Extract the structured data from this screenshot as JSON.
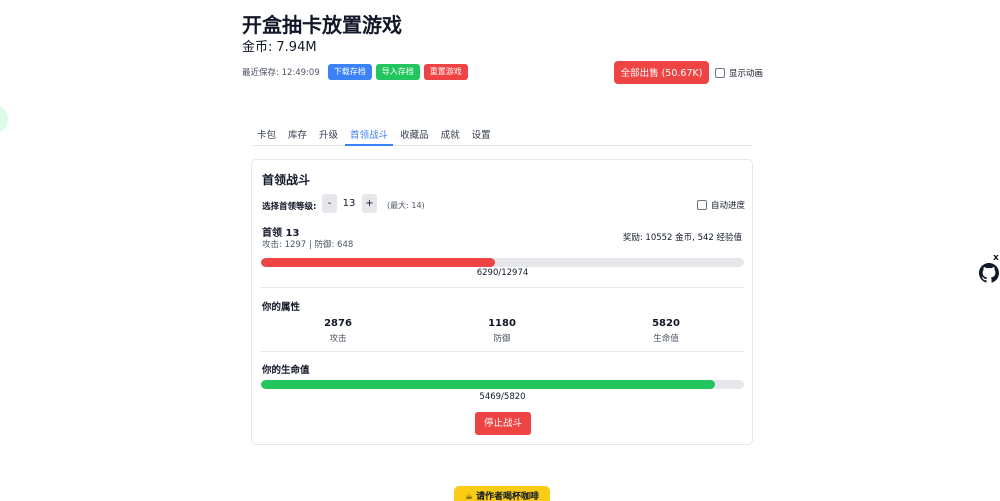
{
  "header": {
    "title": "开盒抽卡放置游戏",
    "gold_label": "金币:",
    "gold_value": "7.94M"
  },
  "save_bar": {
    "last_saved": "最近保存: 12:49:09",
    "download_label": "下载存档",
    "import_label": "导入存档",
    "reset_label": "重置游戏"
  },
  "actions": {
    "sell_all_label": "全部出售 (50.67K)",
    "show_animation_label": "显示动画",
    "show_animation_checked": false
  },
  "tabs": [
    {
      "label": "卡包",
      "active": false
    },
    {
      "label": "库存",
      "active": false
    },
    {
      "label": "升级",
      "active": false
    },
    {
      "label": "首领战斗",
      "active": true
    },
    {
      "label": "收藏品",
      "active": false
    },
    {
      "label": "成就",
      "active": false
    },
    {
      "label": "设置",
      "active": false
    }
  ],
  "boss_battle": {
    "title": "首领战斗",
    "select_level_label": "选择首领等级:",
    "minus_label": "-",
    "plus_label": "+",
    "level": "13",
    "max_label": "(最大: 14)",
    "auto_progress_label": "自动进度",
    "auto_progress_checked": false,
    "boss": {
      "name": "首领 13",
      "stats": "攻击: 1297 | 防御: 648",
      "reward": "奖励: 10552 金币, 542 经验值",
      "hp_text": "6290/12974",
      "hp_current": 6290,
      "hp_max": 12974
    },
    "attributes": {
      "title": "你的属性",
      "items": [
        {
          "value": "2876",
          "label": "攻击"
        },
        {
          "value": "1180",
          "label": "防御"
        },
        {
          "value": "5820",
          "label": "生命值"
        }
      ]
    },
    "player_hp": {
      "title": "你的生命值",
      "hp_text": "5469/5820",
      "hp_current": 5469,
      "hp_max": 5820
    },
    "stop_label": "停止战斗"
  },
  "footer": {
    "coffee_label": "请作者喝杯咖啡",
    "coffee_icon": "coffee-icon"
  },
  "widget": {
    "close_label": "x",
    "icon": "github-icon"
  },
  "colors": {
    "accent_blue": "#3b82f6",
    "success_green": "#22c55e",
    "danger_red": "#ef4444",
    "coffee_yellow": "#facc15"
  }
}
